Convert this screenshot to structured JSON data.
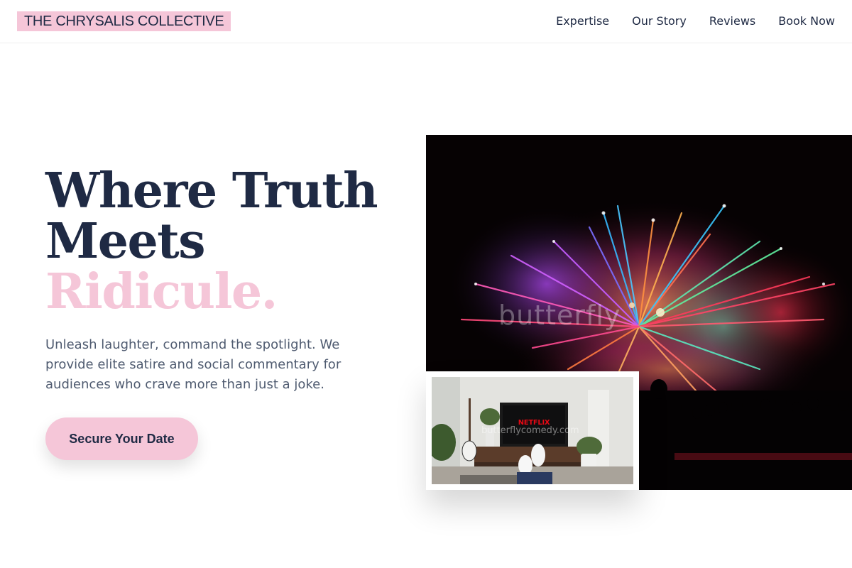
{
  "header": {
    "brand": "THE CHRYSALIS COLLECTIVE",
    "nav": [
      {
        "label": "Expertise"
      },
      {
        "label": "Our Story"
      },
      {
        "label": "Reviews"
      },
      {
        "label": "Book Now"
      }
    ]
  },
  "hero": {
    "headline_line1": "Where Truth",
    "headline_line2": "Meets",
    "headline_accent": "Ridicule.",
    "lede": "Unleash laughter, command the spotlight. We provide elite satire and social commentary for audiences who crave more than just a joke.",
    "cta_label": "Secure Your Date"
  },
  "images": {
    "main_watermark": "butterfly",
    "inset_screen_text": "NETFLIX",
    "inset_watermark": "butterflycomedy.com"
  },
  "colors": {
    "accent_pink": "#f5c6d8",
    "navy_text": "#1f2a44",
    "body_text": "#4f5b70",
    "photo_background": "#060203"
  }
}
